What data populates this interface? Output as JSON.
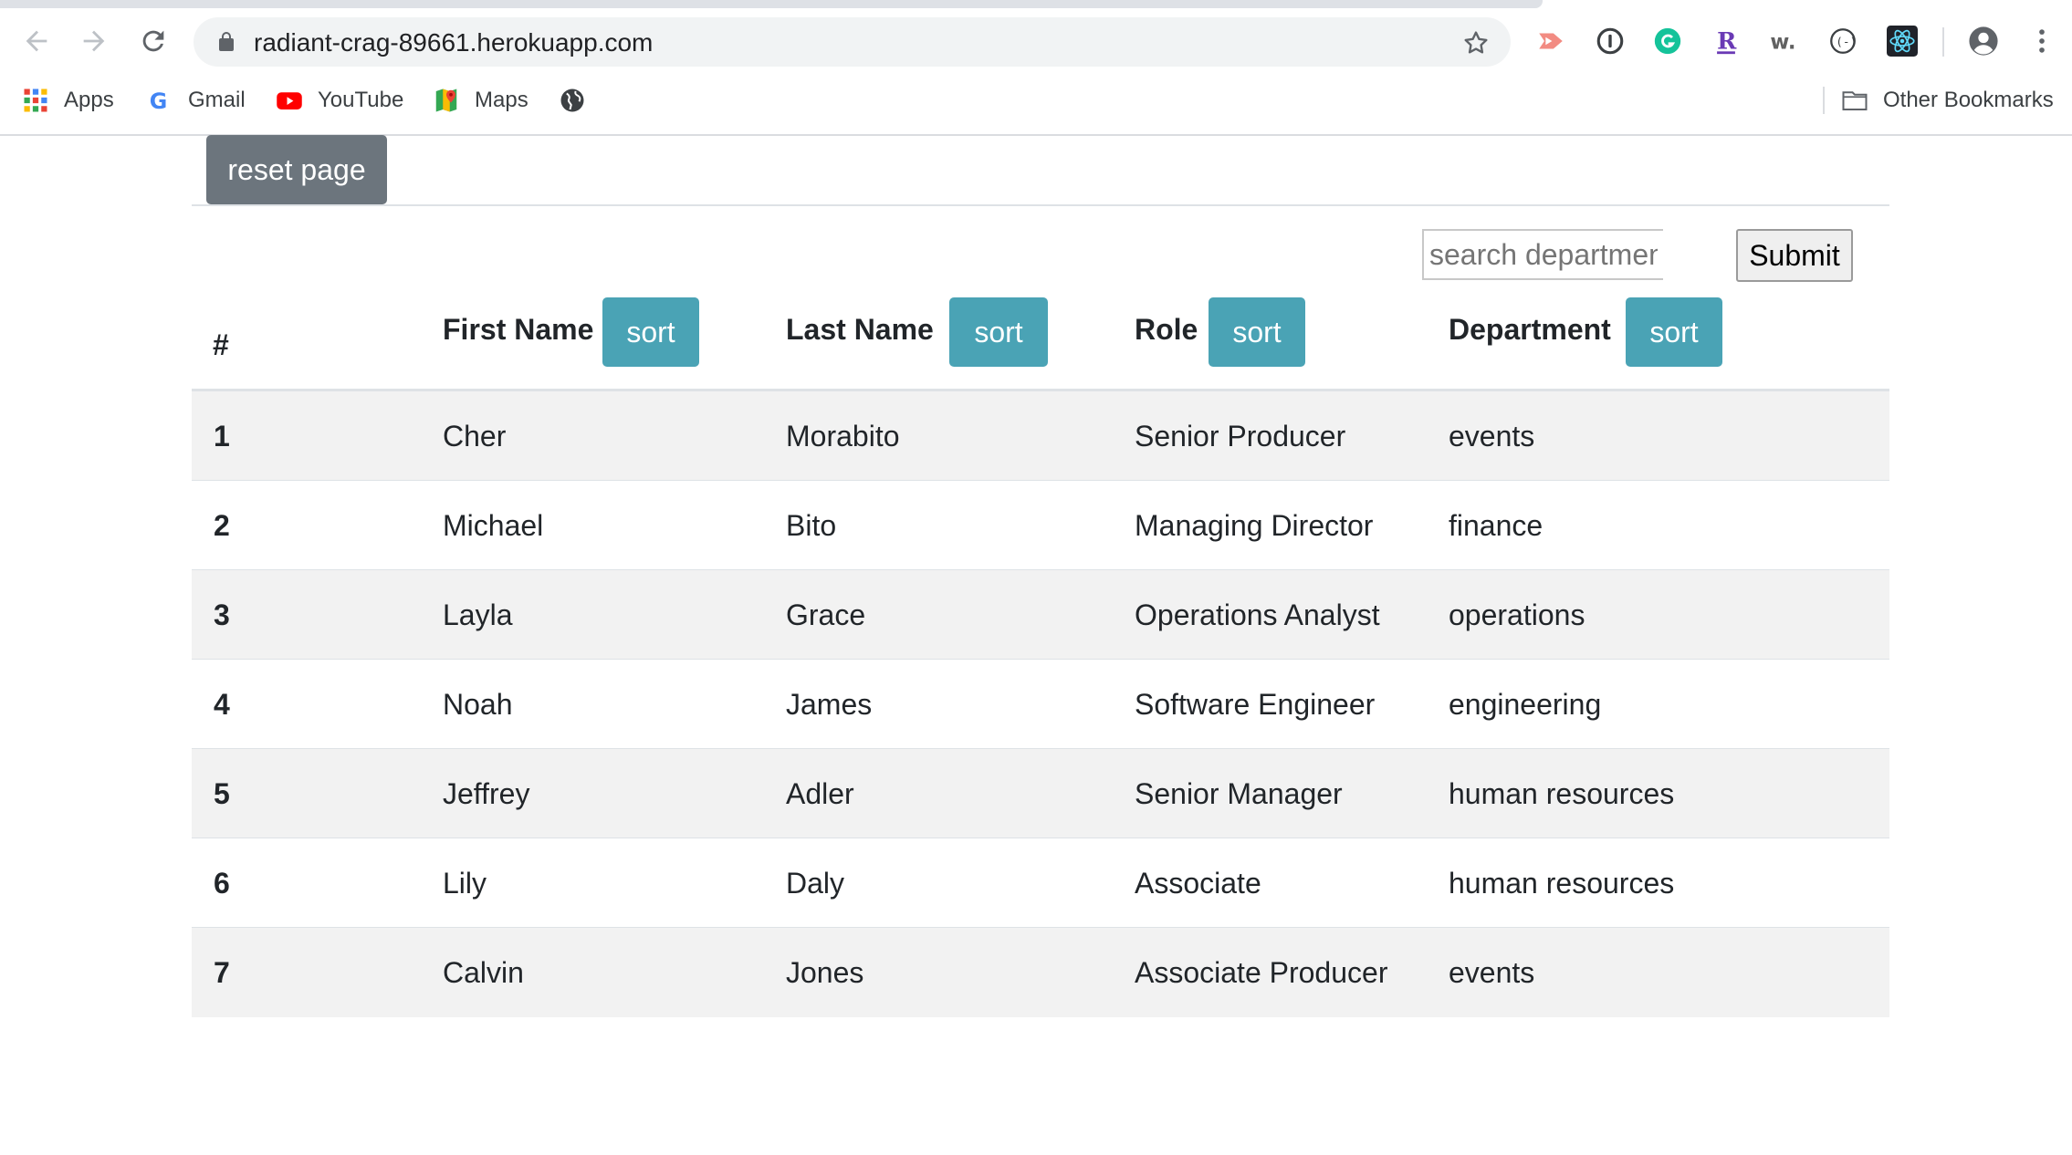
{
  "browser": {
    "url": "radiant-crag-89661.herokuapp.com",
    "extensions": [
      "cast-icon",
      "1password-icon",
      "grammarly-icon",
      "rx-icon",
      "w-icon",
      "dev-tools-icon",
      "react-icon",
      "account-icon",
      "menu-icon"
    ],
    "bookmarks": {
      "apps": "Apps",
      "gmail": "Gmail",
      "youtube": "YouTube",
      "maps": "Maps",
      "other": "Other Bookmarks"
    }
  },
  "page": {
    "reset_label": "reset page",
    "search": {
      "placeholder": "search department",
      "value": ""
    },
    "submit_label": "Submit",
    "sort_label": "sort",
    "columns": {
      "num": "#",
      "first_name": "First Name",
      "last_name": "Last Name",
      "role": "Role",
      "department": "Department"
    },
    "rows": [
      {
        "num": "1",
        "first_name": "Cher",
        "last_name": "Morabito",
        "role": "Senior Producer",
        "department": "events"
      },
      {
        "num": "2",
        "first_name": "Michael",
        "last_name": "Bito",
        "role": "Managing Director",
        "department": "finance"
      },
      {
        "num": "3",
        "first_name": "Layla",
        "last_name": "Grace",
        "role": "Operations Analyst",
        "department": "operations"
      },
      {
        "num": "4",
        "first_name": "Noah",
        "last_name": "James",
        "role": "Software Engineer",
        "department": "engineering"
      },
      {
        "num": "5",
        "first_name": "Jeffrey",
        "last_name": "Adler",
        "role": "Senior Manager",
        "department": "human resources"
      },
      {
        "num": "6",
        "first_name": "Lily",
        "last_name": "Daly",
        "role": "Associate",
        "department": "human resources"
      },
      {
        "num": "7",
        "first_name": "Calvin",
        "last_name": "Jones",
        "role": "Associate Producer",
        "department": "events"
      }
    ]
  },
  "colors": {
    "sort_button": "#4aa3b5",
    "reset_button": "#6c757d",
    "stripe": "#f2f2f2"
  }
}
